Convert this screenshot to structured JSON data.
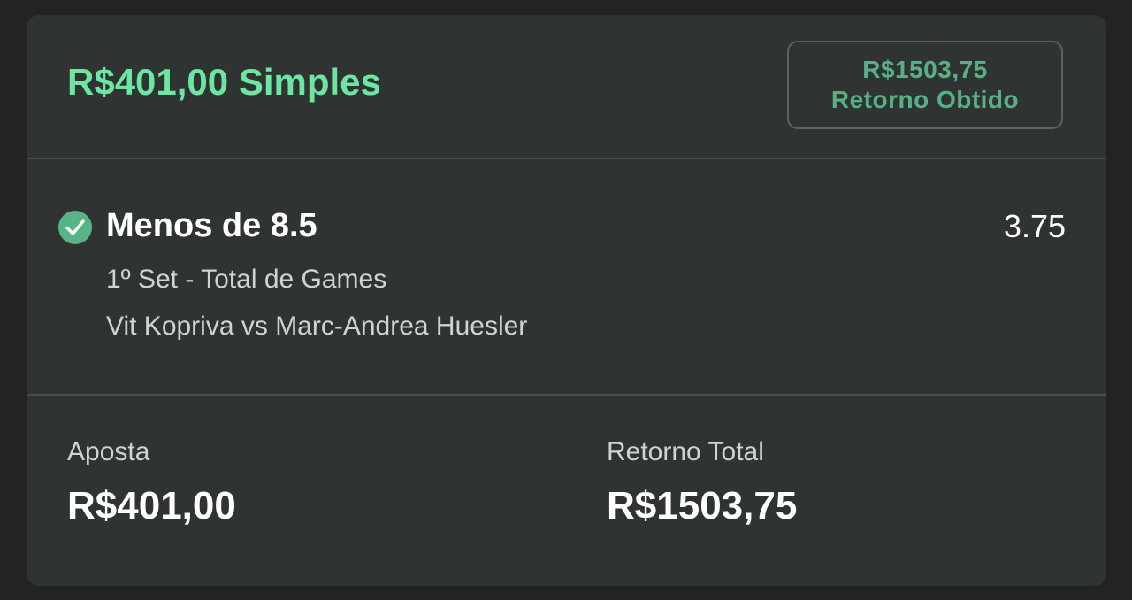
{
  "header": {
    "title": "R$401,00 Simples",
    "returned_amount": "R$1503,75",
    "returned_label": "Retorno Obtido"
  },
  "selection": {
    "status_icon": "check-circle-icon",
    "name": "Menos de 8.5",
    "odds": "3.75",
    "market": "1º Set - Total de Games",
    "event": "Vit Kopriva vs Marc-Andrea Huesler"
  },
  "summary": {
    "stake_label": "Aposta",
    "stake_value": "R$401,00",
    "total_return_label": "Retorno Total",
    "total_return_value": "R$1503,75"
  },
  "colors": {
    "accent_green": "#6ee6a3",
    "badge_green": "#57b184",
    "check_green": "#56b486",
    "card_bg": "#2f3432"
  }
}
